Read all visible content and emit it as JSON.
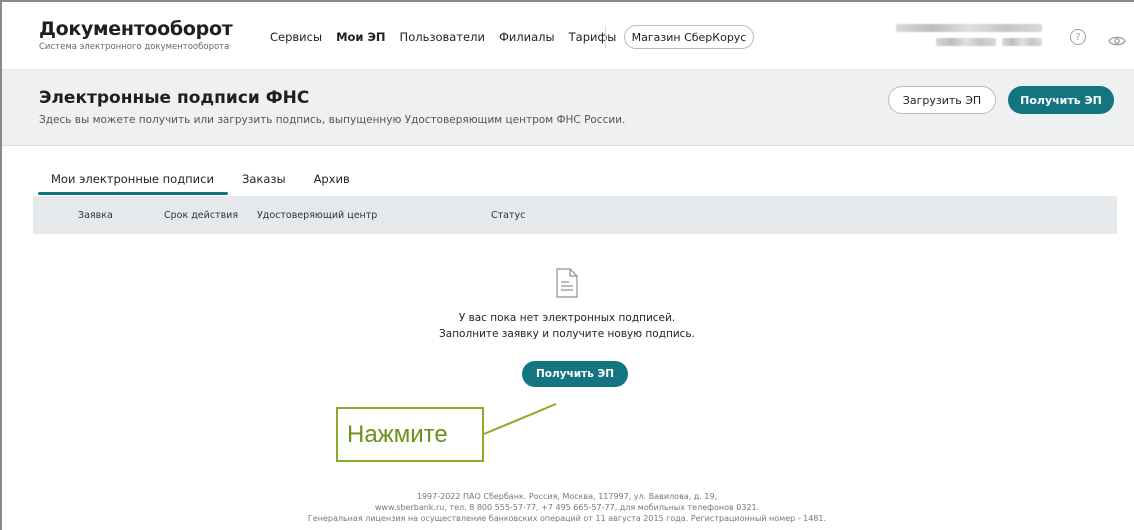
{
  "header": {
    "logo_title": "Документооборот",
    "logo_subtitle": "Система электронного документооборота",
    "nav": [
      "Сервисы",
      "Мои ЭП",
      "Пользователи",
      "Филиалы",
      "Тарифы"
    ],
    "active_nav": "Мои ЭП",
    "shop_label": "Магазин СберКорус",
    "help_icon": "question-circle-icon",
    "eye_icon": "eye-icon"
  },
  "title_band": {
    "title": "Электронные подписи ФНС",
    "subtitle": "Здесь вы можете получить или загрузить подпись, выпущенную Удостоверяющим центром ФНС России.",
    "upload_label": "Загрузить ЭП",
    "get_label": "Получить ЭП"
  },
  "tabs": [
    {
      "label": "Мои электронные подписи",
      "active": true
    },
    {
      "label": "Заказы",
      "active": false
    },
    {
      "label": "Архив",
      "active": false
    }
  ],
  "table": {
    "columns": [
      "Заявка",
      "Срок действия",
      "Удостоверяющий центр",
      "Статус"
    ]
  },
  "empty_state": {
    "icon": "document-icon",
    "line1": "У вас пока нет электронных подписей.",
    "line2": "Заполните заявку и получите новую подпись.",
    "button_label": "Получить ЭП"
  },
  "annotation": {
    "text": "Нажмите"
  },
  "footer": {
    "line1": "1997-2022 ПАО Сбербанк. Россия, Москва, 117997, ул. Вавилова, д. 19,",
    "line2": "www.sberbank.ru, тел. 8 800 555-57-77, +7 495 665-57-77, для мобильных телефонов 0321.",
    "line3": "Генеральная лицензия на осуществление банковских операций от 11 августа 2015 года. Регистрационный номер - 1481."
  },
  "colors": {
    "primary": "#127580",
    "annotation": "#8aaa2a"
  }
}
